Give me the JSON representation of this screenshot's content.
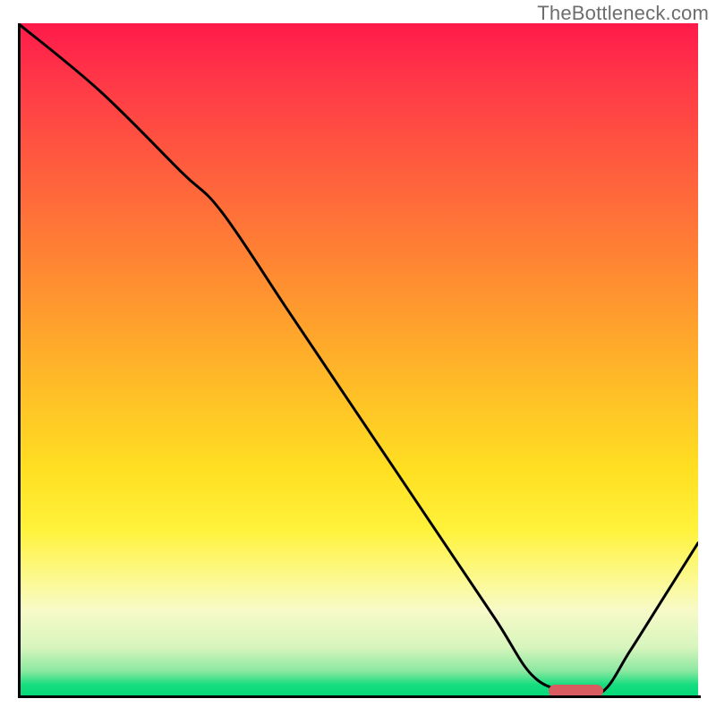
{
  "watermark": "TheBottleneck.com",
  "colors": {
    "gradient_top": "#ff1a4a",
    "gradient_mid": "#ffe030",
    "gradient_bottom": "#00d977",
    "curve": "#000000",
    "axis": "#000000",
    "marker": "#d85c60"
  },
  "chart_data": {
    "type": "line",
    "title": "",
    "xlabel": "",
    "ylabel": "",
    "xlim": [
      0,
      100
    ],
    "ylim": [
      0,
      100
    ],
    "x": [
      0,
      12,
      24,
      30,
      40,
      50,
      60,
      70,
      76,
      82,
      86,
      90,
      95,
      100
    ],
    "values": [
      100,
      90,
      78,
      72,
      57,
      42,
      27,
      12,
      3,
      1,
      1,
      7,
      15,
      23
    ],
    "marker": {
      "x_start": 78,
      "x_end": 86,
      "y": 0.5
    },
    "annotations": []
  }
}
